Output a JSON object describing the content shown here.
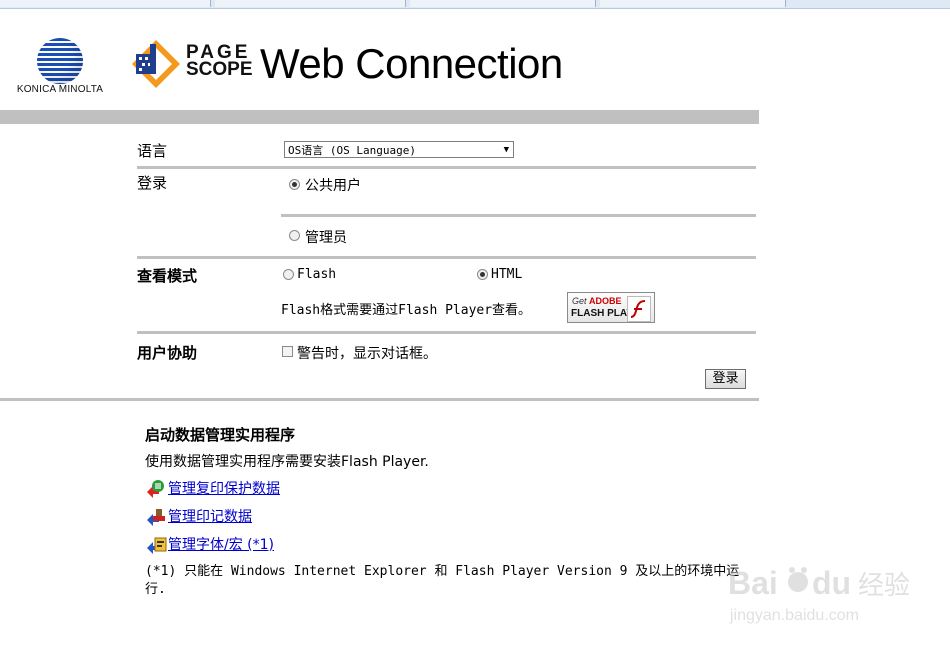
{
  "brand": {
    "konica_text": "KONICA MINOLTA",
    "pagescope_line1": "PAGE",
    "pagescope_line2": "SCOPE",
    "title": "Web Connection"
  },
  "form": {
    "language": {
      "label": "语言",
      "selected": "OS语言 (OS Language)"
    },
    "login": {
      "label": "登录",
      "options": [
        {
          "label": "公共用户",
          "checked": true
        },
        {
          "label": "管理员",
          "checked": false
        }
      ]
    },
    "view_mode": {
      "label": "查看模式",
      "options": [
        {
          "label": "Flash",
          "checked": false
        },
        {
          "label": "HTML",
          "checked": true
        }
      ],
      "note": "Flash格式需要通过Flash Player查看。",
      "badge_get": "Get",
      "badge_adobe": "ADOBE",
      "badge_flash": "FLASH PLAYER"
    },
    "user_assist": {
      "label": "用户协助",
      "checkbox": "警告时，显示对话框。",
      "checked": false
    },
    "login_button": "登录"
  },
  "data_utility": {
    "title": "启动数据管理实用程序",
    "description": "使用数据管理实用程序需要安装Flash Player.",
    "links": [
      "管理复印保护数据",
      "管理印记数据",
      "管理字体/宏 (*1)"
    ],
    "note": "(*1) 只能在 Windows Internet Explorer 和 Flash Player Version 9 及以上的环境中运行."
  },
  "colors": {
    "separator": "#c0c0c0",
    "link": "#0000cc",
    "brand_blue": "#1a4fb5"
  },
  "icons": [
    "konica-minolta-globe-icon",
    "pagescope-logo-icon",
    "dropdown-arrow-icon",
    "flash-player-icon",
    "copy-protect-icon",
    "stamp-icon",
    "font-macro-icon"
  ]
}
